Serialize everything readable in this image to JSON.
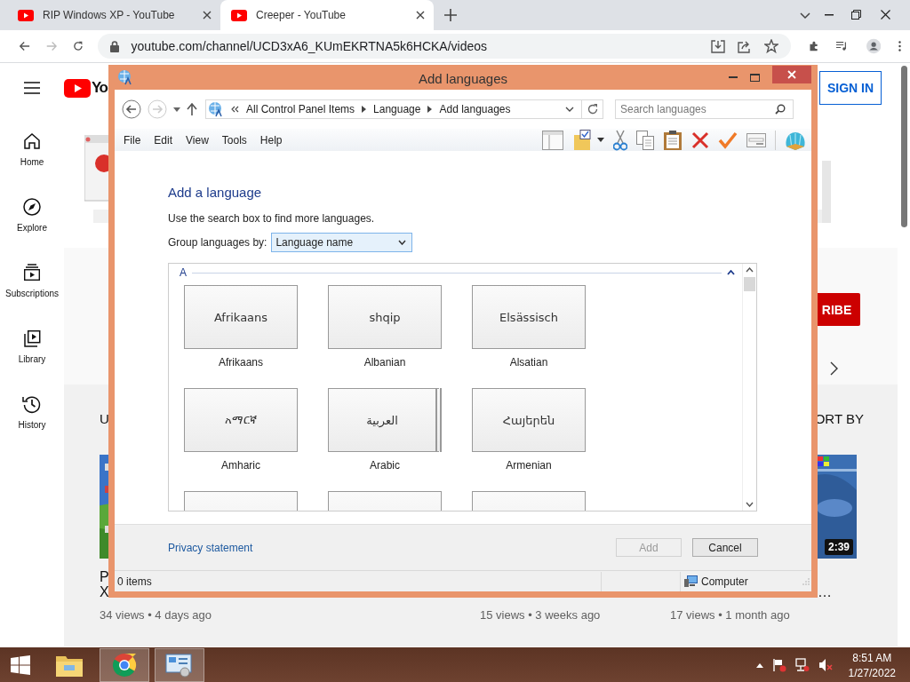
{
  "browser": {
    "tabs": [
      {
        "title": "RIP Windows XP - YouTube",
        "selected": false
      },
      {
        "title": "Creeper - YouTube",
        "selected": true
      }
    ],
    "url": "youtube.com/channel/UCD3xA6_KUmEKRTNA5k6HCKA/videos"
  },
  "youtube": {
    "logo_text": "Yo",
    "sign_in": "SIGN IN",
    "sidebar": [
      {
        "kind": "home",
        "label": "Home"
      },
      {
        "kind": "explore",
        "label": "Explore"
      },
      {
        "kind": "subscriptions",
        "label": "Subscriptions"
      },
      {
        "kind": "library",
        "label": "Library"
      },
      {
        "kind": "history",
        "label": "History"
      }
    ],
    "subscribe": "RIBE",
    "section_title": "U",
    "sort": "ORT BY",
    "videos": [
      {
        "kind": "picture",
        "title_lines": [
          "P",
          "X"
        ],
        "meta": "34 views • 4 days ago"
      },
      {
        "meta": "15 views • 3 weeks ago"
      },
      {
        "kind": "picture",
        "duration": "2:39",
        "title_tail": "…",
        "meta": "17 views • 1 month ago"
      }
    ]
  },
  "dialog": {
    "title": "Add languages",
    "breadcrumb": [
      "All Control Panel Items",
      "Language",
      "Add languages"
    ],
    "search_placeholder": "Search languages",
    "menu": [
      "File",
      "Edit",
      "View",
      "Tools",
      "Help"
    ],
    "heading": "Add a language",
    "hint": "Use the search box to find more languages.",
    "group_label": "Group languages by:",
    "group_value": "Language name",
    "section": "A",
    "languages": [
      {
        "native": "Afrikaans",
        "name": "Afrikaans",
        "stacked": false
      },
      {
        "native": "shqip",
        "name": "Albanian",
        "stacked": false
      },
      {
        "native": "Elsässisch",
        "name": "Alsatian",
        "stacked": false
      },
      {
        "native": "አማርኛ",
        "name": "Amharic",
        "stacked": false
      },
      {
        "native": "العربية",
        "name": "Arabic",
        "stacked": true
      },
      {
        "native": "Հայերեն",
        "name": "Armenian",
        "stacked": false
      }
    ],
    "privacy": "Privacy statement",
    "buttons": [
      {
        "label": "Add",
        "disabled": true
      },
      {
        "label": "Cancel",
        "disabled": false
      }
    ],
    "status": {
      "items": "0 items",
      "location": "Computer"
    }
  },
  "taskbar": {
    "apps": [
      {
        "kind": "explorer",
        "active": false
      },
      {
        "kind": "chrome",
        "active": true
      },
      {
        "kind": "control-panel",
        "active": true
      }
    ],
    "time": "8:51 AM",
    "date": "1/27/2022"
  }
}
